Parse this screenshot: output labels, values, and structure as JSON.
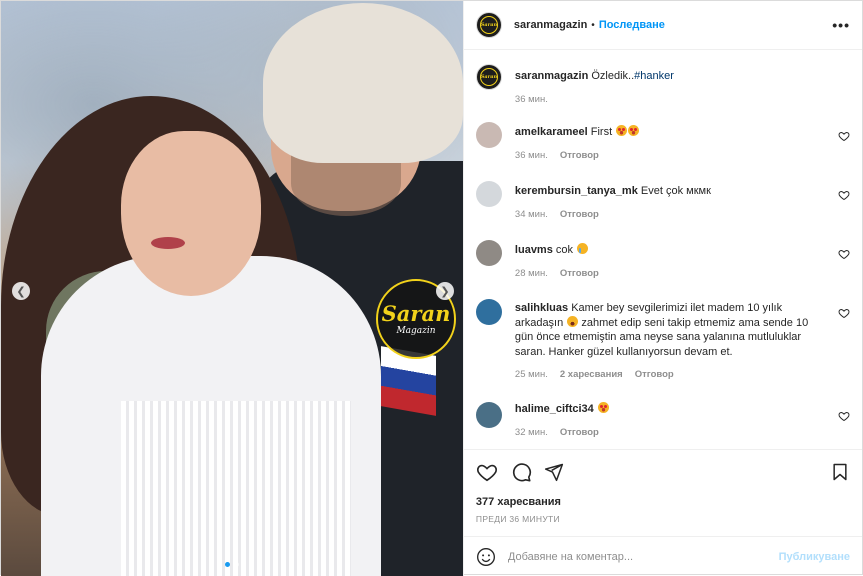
{
  "post": {
    "image_overlay": {
      "brand": "Saran",
      "brand_sub": "Magazin"
    },
    "carousel": {
      "total": 2,
      "active": 1
    }
  },
  "header": {
    "username": "saranmagazin",
    "separator": "•",
    "follow_label": "Последване",
    "more_icon": "more-horizontal-icon"
  },
  "caption": {
    "username": "saranmagazin",
    "text": "Özledik..",
    "hashtag": "#hanker",
    "time": "36 мин."
  },
  "comments": [
    {
      "username": "amelkarameel",
      "text": "First",
      "emoji": [
        "heart-eyes",
        "heart-eyes"
      ],
      "time": "36 мин.",
      "likes": "",
      "reply": "Отговор",
      "avatar_color": "#c9b9b3"
    },
    {
      "username": "kerembursin_tanya_mk",
      "text": "Evet çok мкмк",
      "emoji": [],
      "time": "34 мин.",
      "likes": "",
      "reply": "Отговор",
      "avatar_color": "#d4d8dc"
    },
    {
      "username": "luavms",
      "text": "cok",
      "emoji": [
        "cry"
      ],
      "time": "28 мин.",
      "likes": "",
      "reply": "Отговор",
      "avatar_color": "#8f8a85"
    },
    {
      "username": "salihkluas",
      "text": "Kamer bey sevgilerimizi ilet madem 10 yılık arkadaşın",
      "text2": "zahmet edip seni takip etmemiz ama sende 10 gün önce etmemiştin ama neyse sana yalanına mutluluklar saran. Hanker güzel kullanıyorsun devam et.",
      "emoji": [
        "laugh"
      ],
      "time": "25 мин.",
      "likes": "2 харесвания",
      "reply": "Отговор",
      "avatar_color": "#2f6f9e"
    },
    {
      "username": "halime_ciftci34",
      "text": "",
      "emoji": [
        "heart-eyes"
      ],
      "time": "32 мин.",
      "likes": "",
      "reply": "Отговор",
      "avatar_color": "#4a6f86"
    }
  ],
  "actions": {
    "like_icon": "heart-icon",
    "comment_icon": "comment-icon",
    "share_icon": "send-icon",
    "save_icon": "bookmark-icon",
    "likes_count": "377 харесвания",
    "posted_ago": "ПРЕДИ 36 МИНУТИ"
  },
  "add_comment": {
    "emoji_icon": "smiley-icon",
    "placeholder": "Добавяне на коментар...",
    "post_label": "Публикуване"
  },
  "colors": {
    "accent": "#0095f6",
    "post_disabled": "#b2dffc",
    "brand_yellow": "#f2d21b",
    "text": "#262626",
    "muted": "#8e8e8e"
  }
}
